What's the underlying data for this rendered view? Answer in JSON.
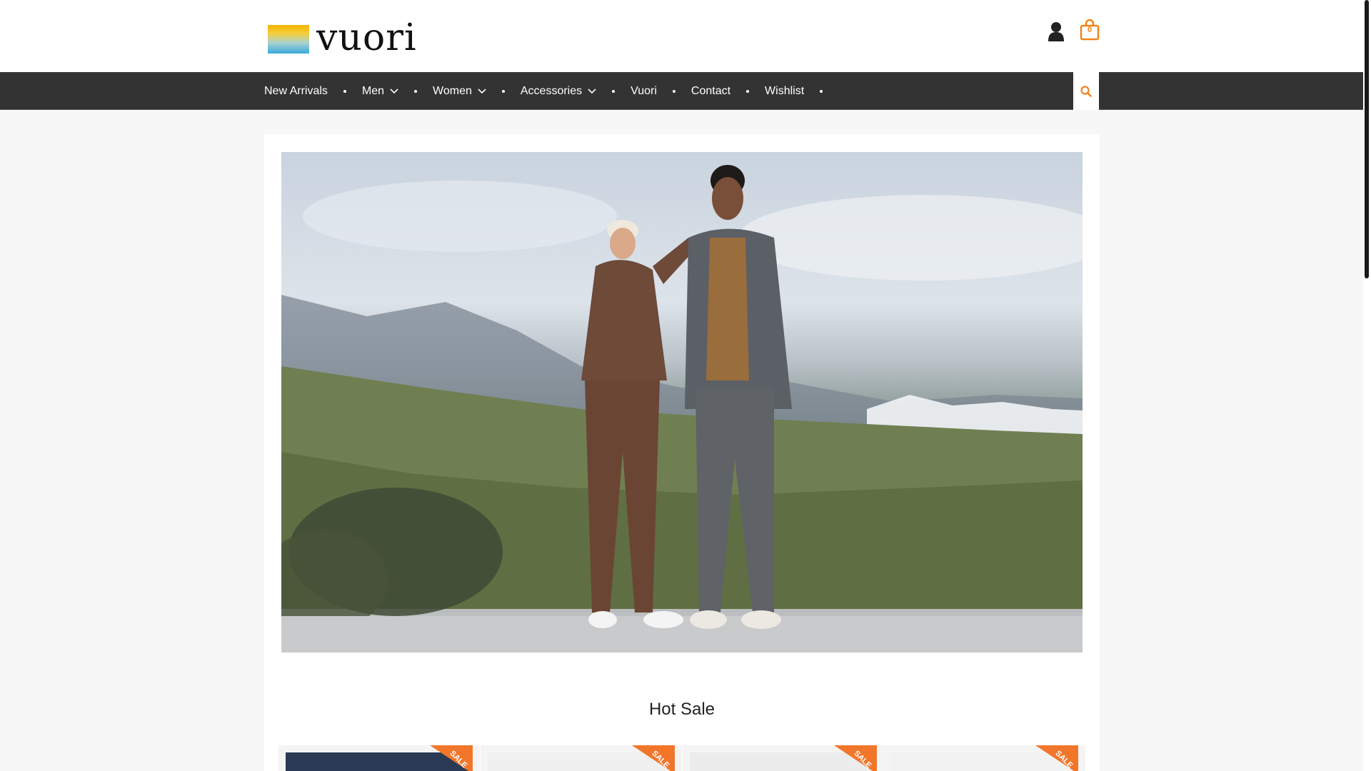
{
  "brand": {
    "name": "vuori"
  },
  "header": {
    "cart_count": "0"
  },
  "nav": {
    "items": [
      {
        "label": "New Arrivals",
        "dropdown": false
      },
      {
        "label": "Men",
        "dropdown": true
      },
      {
        "label": "Women",
        "dropdown": true
      },
      {
        "label": "Accessories",
        "dropdown": true
      },
      {
        "label": "Vuori",
        "dropdown": false
      },
      {
        "label": "Contact",
        "dropdown": false
      },
      {
        "label": "Wishlist",
        "dropdown": false
      }
    ]
  },
  "sections": {
    "hot_sale_title": "Hot Sale"
  },
  "products": [
    {
      "badge": "SALE"
    },
    {
      "badge": "SALE"
    },
    {
      "badge": "SALE"
    },
    {
      "badge": "SALE"
    }
  ],
  "colors": {
    "accent": "#f0841a",
    "nav_bg": "#333333",
    "sale": "#f2762a"
  },
  "icons": [
    "user-icon",
    "shopping-bag-icon",
    "chevron-down-icon",
    "search-icon"
  ]
}
